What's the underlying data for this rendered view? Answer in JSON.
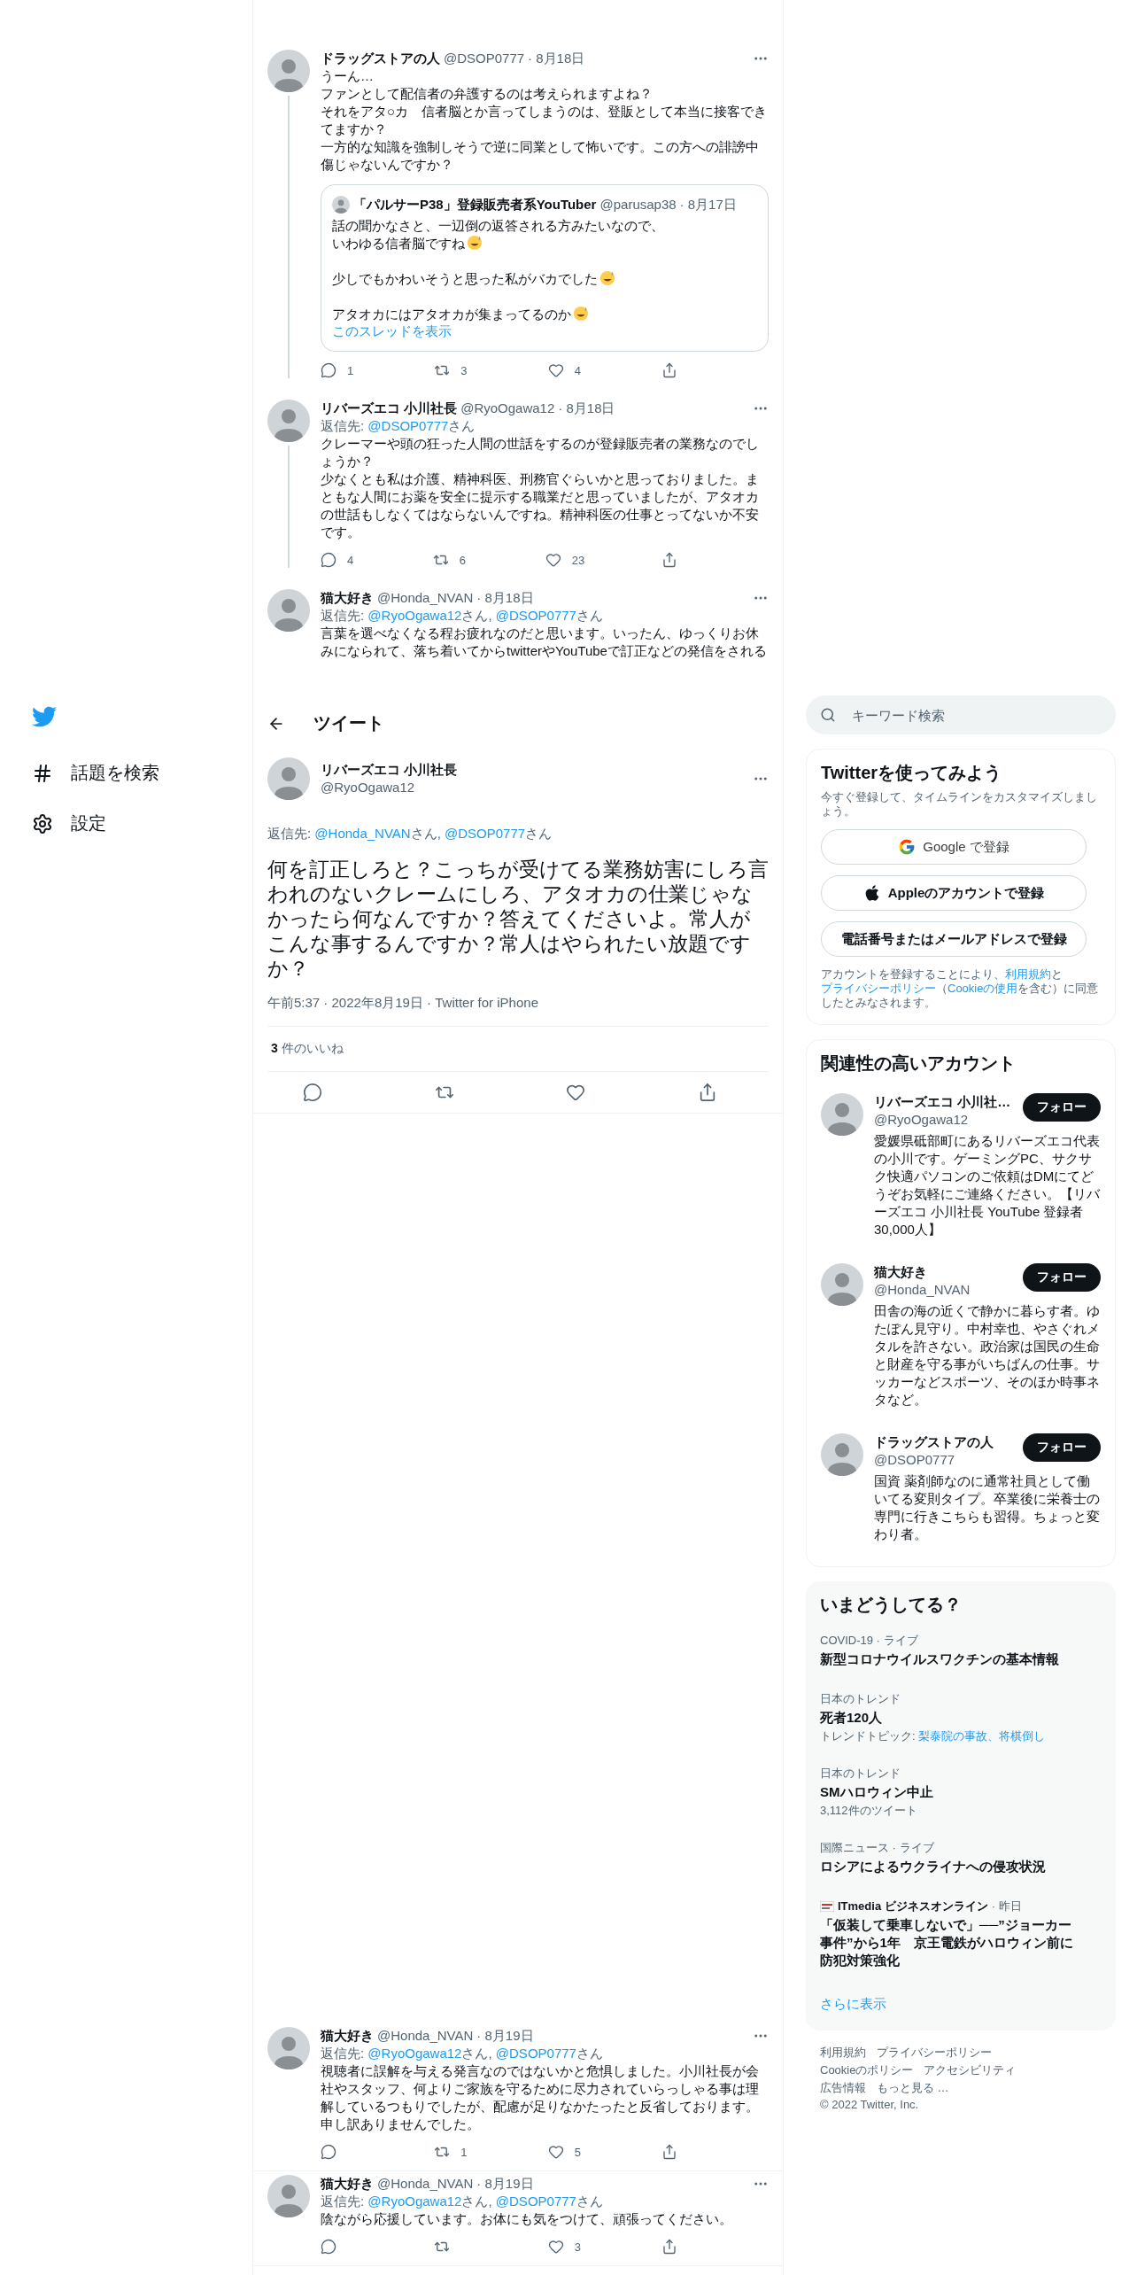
{
  "nav": {
    "items": [
      {
        "kind": "hash",
        "label": "話題を検索"
      },
      {
        "kind": "gear",
        "label": "設定"
      }
    ]
  },
  "thread": [
    {
      "name": "ドラッグストアの人",
      "handle": "@DSOP0777",
      "date": "· 8月18日",
      "lines": [
        "うーん…",
        "ファンとして配信者の弁護するのは考えられますよね？",
        "それをアタ○カ　信者脳とか言ってしまうのは、登販として本当に接客できてますか？",
        "一方的な知識を強制しそうで逆に同業として怖いです。この方への誹謗中傷じゃないんですか？"
      ],
      "quote": {
        "name": "「パルサーP38」登録販売者系YouTuber",
        "handle": "@parusap38",
        "date": "· 8月17日",
        "paragraphs": [
          {
            "lines": [
              "話の聞かなさと、一辺倒の返答される方みたいなので、",
              "いわゆる信者脳ですね"
            ],
            "emoji": true
          },
          {
            "lines": [
              "少しでもかわいそうと思った私がバカでした"
            ],
            "emoji": true
          },
          {
            "lines": [
              "アタオカにはアタオカが集まってるのか"
            ],
            "emoji": true
          }
        ],
        "link": "このスレッドを表示"
      },
      "actions": [
        {
          "kind": "reply",
          "count": "1"
        },
        {
          "kind": "retweet",
          "count": "3"
        },
        {
          "kind": "like",
          "count": "4"
        },
        {
          "kind": "share"
        }
      ]
    },
    {
      "name": "リバーズエコ 小川社長",
      "handle": "@RyoOgawa12",
      "date": "· 8月18日",
      "reply_to": [
        {
          "kind": "text",
          "text": "返信先: "
        },
        {
          "kind": "link",
          "text": "@DSOP0777"
        },
        {
          "kind": "text",
          "text": "さん"
        }
      ],
      "lines": [
        "クレーマーや頭の狂った人間の世話をするのが登録販売者の業務なのでしょうか？",
        "少なくとも私は介護、精神科医、刑務官ぐらいかと思っておりました。まともな人間にお薬を安全に提示する職業だと思っていましたが、アタオカの世話もしなくてはならないんですね。精神科医の仕事とってないか不安です。"
      ],
      "actions": [
        {
          "kind": "reply",
          "count": "4"
        },
        {
          "kind": "retweet",
          "count": "6"
        },
        {
          "kind": "like",
          "count": "23"
        },
        {
          "kind": "share"
        }
      ]
    },
    {
      "name": "猫大好き",
      "handle": "@Honda_NVAN",
      "date": "· 8月18日",
      "reply_to": [
        {
          "kind": "text",
          "text": "返信先: "
        },
        {
          "kind": "link",
          "text": "@RyoOgawa12"
        },
        {
          "kind": "text",
          "text": "さん, "
        },
        {
          "kind": "link",
          "text": "@DSOP0777"
        },
        {
          "kind": "text",
          "text": "さん"
        }
      ],
      "text": "言葉を選べなくなる程お疲れなのだと思います。いったん、ゆっくりお休みになられて、落ち着いてからtwitterやYouTubeで訂正などの発信をされる"
    }
  ],
  "header": {
    "title": "ツイート"
  },
  "main_tweet": {
    "name": "リバーズエコ 小川社長",
    "handle": "@RyoOgawa12",
    "reply_to": [
      {
        "kind": "text",
        "text": "返信先: "
      },
      {
        "kind": "link",
        "text": "@Honda_NVAN"
      },
      {
        "kind": "text",
        "text": "さん, "
      },
      {
        "kind": "link",
        "text": "@DSOP0777"
      },
      {
        "kind": "text",
        "text": "さん"
      }
    ],
    "text": "何を訂正しろと？こっちが受けてる業務妨害にしろ言われのないクレームにしろ、アタオカの仕業じゃなかったら何なんですか？答えてくださいよ。常人がこんな事するんですか？常人はやられたい放題ですか？",
    "meta": "午前5:37 · 2022年8月19日 · Twitter for iPhone",
    "likes": {
      "count": "3",
      "label": "件のいいね"
    },
    "actions": [
      {
        "kind": "reply"
      },
      {
        "kind": "retweet"
      },
      {
        "kind": "like"
      },
      {
        "kind": "share"
      }
    ]
  },
  "replies": [
    {
      "name": "猫大好き",
      "handle": "@Honda_NVAN",
      "date": "· 8月19日",
      "reply_to": [
        {
          "kind": "text",
          "text": "返信先: "
        },
        {
          "kind": "link",
          "text": "@RyoOgawa12"
        },
        {
          "kind": "text",
          "text": "さん, "
        },
        {
          "kind": "link",
          "text": "@DSOP0777"
        },
        {
          "kind": "text",
          "text": "さん"
        }
      ],
      "text": "視聴者に誤解を与える発言なのではないかと危惧しました。小川社長が会社やスタッフ、何よりご家族を守るために尽力されていらっしゃる事は理解しているつもりでしたが、配慮が足りなかたったと反省しております。申し訳ありませんでした。",
      "actions": [
        {
          "kind": "reply"
        },
        {
          "kind": "retweet",
          "count": "1"
        },
        {
          "kind": "like",
          "count": "5"
        },
        {
          "kind": "share"
        }
      ]
    },
    {
      "name": "猫大好き",
      "handle": "@Honda_NVAN",
      "date": "· 8月19日",
      "reply_to": [
        {
          "kind": "text",
          "text": "返信先: "
        },
        {
          "kind": "link",
          "text": "@RyoOgawa12"
        },
        {
          "kind": "text",
          "text": "さん, "
        },
        {
          "kind": "link",
          "text": "@DSOP0777"
        },
        {
          "kind": "text",
          "text": "さん"
        }
      ],
      "text": "陰ながら応援しています。お体にも気をつけて、頑張ってください。",
      "actions": [
        {
          "kind": "reply"
        },
        {
          "kind": "retweet"
        },
        {
          "kind": "like",
          "count": "3"
        },
        {
          "kind": "share"
        }
      ]
    }
  ],
  "search": {
    "placeholder": "キーワード検索"
  },
  "signup": {
    "title": "Twitterを使ってみよう",
    "subtitle": "今すぐ登録して、タイムラインをカスタマイズしましょう。",
    "buttons": [
      {
        "kind": "google",
        "label": "Google で登録"
      },
      {
        "kind": "apple",
        "label": "Appleのアカウントで登録"
      },
      {
        "kind": "plain",
        "label": "電話番号またはメールアドレスで登録"
      }
    ],
    "terms": [
      {
        "kind": "text",
        "text": "アカウントを登録することにより、"
      },
      {
        "kind": "link",
        "text": "利用規約"
      },
      {
        "kind": "text",
        "text": "と"
      },
      {
        "kind": "link",
        "text": "プライバシーポリシー"
      },
      {
        "kind": "text",
        "text": "（"
      },
      {
        "kind": "link",
        "text": "Cookieの使用"
      },
      {
        "kind": "text",
        "text": "を含む）に同意したとみなされます。"
      }
    ]
  },
  "related": {
    "title": "関連性の高いアカウント",
    "accounts": [
      {
        "name": "リバーズエコ 小川社…",
        "handle": "@RyoOgawa12",
        "bio": "愛媛県砥部町にあるリバーズエコ代表の小川です。ゲーミングPC、サクサク快適パソコンのご依頼はDMにてどうぞお気軽にご連絡ください。【リバーズエコ 小川社長 YouTube 登録者30,000人】",
        "button": "フォロー"
      },
      {
        "name": "猫大好き",
        "handle": "@Honda_NVAN",
        "bio": "田舎の海の近くで静かに暮らす者。ゆたぽん見守り。中村幸也、やさぐれメタルを許さない。政治家は国民の生命と財産を守る事がいちばんの仕事。サッカーなどスポーツ、そのほか時事ネタなど。",
        "button": "フォロー"
      },
      {
        "name": "ドラッグストアの人",
        "handle": "@DSOP0777",
        "bio": "国資 薬剤師なのに通常社員として働いてる変則タイプ。卒業後に栄養士の専門に行きこちらも習得。ちょっと変わり者。",
        "button": "フォロー"
      }
    ]
  },
  "trends": {
    "title": "いまどうしてる？",
    "items": [
      {
        "kind": "trend",
        "context": "COVID-19 · ライブ",
        "title": "新型コロナウイルスワクチンの基本情報"
      },
      {
        "kind": "trend",
        "context": "日本のトレンド",
        "title": "死者120人",
        "topics": [
          {
            "kind": "text",
            "text": "トレンドトピック: "
          },
          {
            "kind": "link",
            "text": "梨泰院の事故"
          },
          {
            "kind": "link",
            "text": "、将棋倒し"
          }
        ]
      },
      {
        "kind": "trend",
        "context": "日本のトレンド",
        "title": "SMハロウィン中止",
        "meta": "3,112件のツイート"
      },
      {
        "kind": "trend",
        "context": "国際ニュース · ライブ",
        "title": "ロシアによるウクライナへの侵攻状況"
      },
      {
        "kind": "news",
        "source": "ITmedia ビジネスオンライン",
        "context": "· 昨日",
        "title": "「仮装して乗車しないで」──”ジョーカー事件”から1年　京王電鉄がハロウィン前に防犯対策強化"
      }
    ],
    "more": "さらに表示"
  },
  "footer": {
    "links": [
      "利用規約",
      "プライバシーポリシー",
      "Cookieのポリシー",
      "アクセシビリティ",
      "広告情報",
      "もっと見る …"
    ],
    "copyright": "© 2022 Twitter, Inc."
  }
}
